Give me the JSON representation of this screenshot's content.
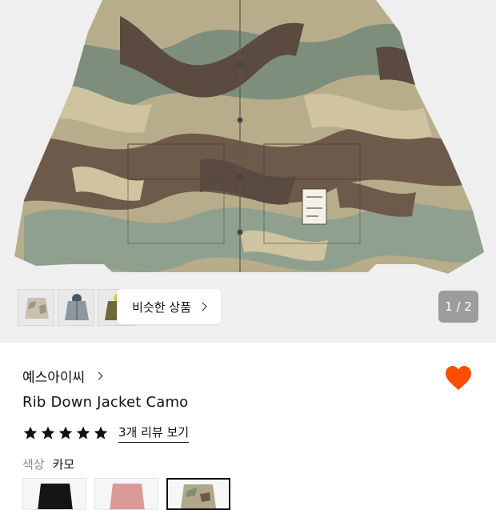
{
  "gallery": {
    "counter": "1 / 2",
    "similar_label": "비슷한 상품",
    "thumbnails": [
      "light-camo-jacket",
      "grey-jacket",
      "olive-jacket"
    ]
  },
  "product": {
    "brand": "예스아이씨",
    "title": "Rib Down Jacket Camo",
    "rating_stars": 5,
    "review_link": "3개 리뷰 보기",
    "wishlisted": true
  },
  "color": {
    "key": "색상",
    "value": "카모",
    "swatches": [
      "black",
      "pink",
      "camo"
    ],
    "selected": "camo"
  },
  "colors": {
    "heart": "#ff4d00",
    "counter_bg": "#9c9c9c",
    "star": "#111111"
  }
}
